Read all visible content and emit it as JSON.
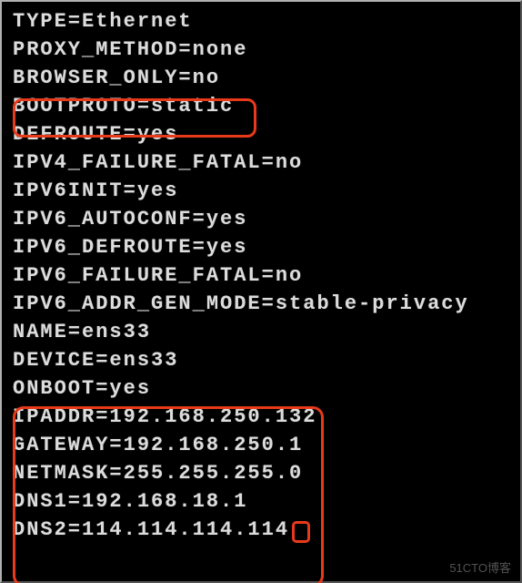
{
  "config": {
    "lines": [
      "TYPE=Ethernet",
      "PROXY_METHOD=none",
      "BROWSER_ONLY=no",
      "BOOTPROTO=static",
      "DEFROUTE=yes",
      "IPV4_FAILURE_FATAL=no",
      "IPV6INIT=yes",
      "IPV6_AUTOCONF=yes",
      "IPV6_DEFROUTE=yes",
      "IPV6_FAILURE_FATAL=no",
      "IPV6_ADDR_GEN_MODE=stable-privacy",
      "NAME=ens33",
      "DEVICE=ens33",
      "ONBOOT=yes",
      "IPADDR=192.168.250.132",
      "GATEWAY=192.168.250.1",
      "NETMASK=255.255.255.0",
      "DNS1=192.168.18.1",
      "DNS2=114.114.114.114"
    ]
  },
  "annotations": {
    "highlight1_target": "BOOTPROTO=static",
    "highlight2_targets": [
      "ONBOOT",
      "IPADDR",
      "GATEWAY",
      "NETMASK",
      "DNS1",
      "DNS2"
    ],
    "highlight_color": "#e83a1a"
  },
  "watermark": "51CTO博客"
}
